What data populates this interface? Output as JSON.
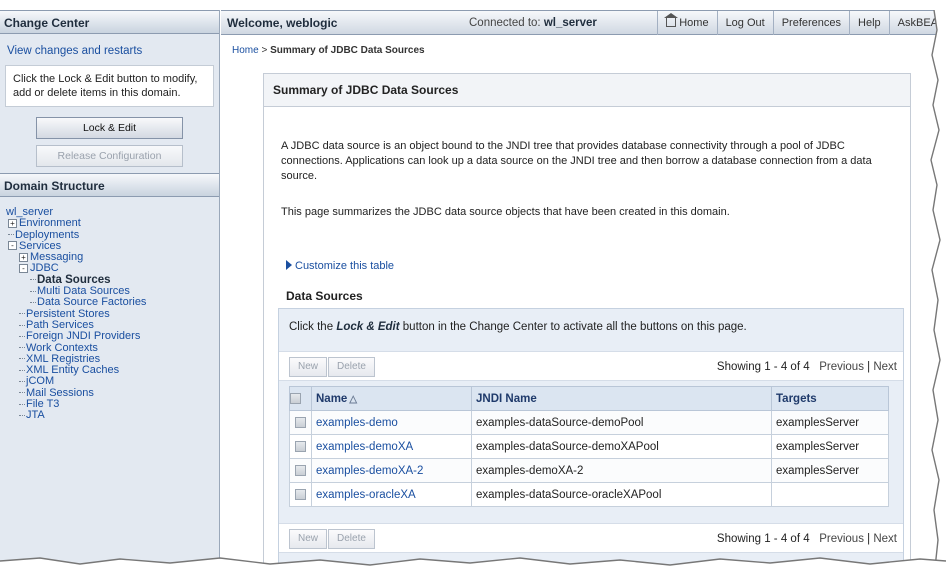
{
  "change_center": {
    "title": "Change Center",
    "link": "View changes and restarts",
    "info": "Click the Lock & Edit button to modify, add or delete items in this domain.",
    "lock_button": "Lock & Edit",
    "release_button": "Release Configuration"
  },
  "domain_structure": {
    "title": "Domain Structure",
    "items": [
      {
        "label": "wl_server",
        "indent": 0,
        "toggle": ""
      },
      {
        "label": "Environment",
        "indent": 1,
        "toggle": "+"
      },
      {
        "label": "Deployments",
        "indent": 1,
        "toggle": ""
      },
      {
        "label": "Services",
        "indent": 1,
        "toggle": "-"
      },
      {
        "label": "Messaging",
        "indent": 2,
        "toggle": "+"
      },
      {
        "label": "JDBC",
        "indent": 2,
        "toggle": "-"
      },
      {
        "label": "Data Sources",
        "indent": 3,
        "toggle": "",
        "current": true
      },
      {
        "label": "Multi Data Sources",
        "indent": 3,
        "toggle": ""
      },
      {
        "label": "Data Source Factories",
        "indent": 3,
        "toggle": ""
      },
      {
        "label": "Persistent Stores",
        "indent": 2,
        "toggle": ""
      },
      {
        "label": "Path Services",
        "indent": 2,
        "toggle": ""
      },
      {
        "label": "Foreign JNDI Providers",
        "indent": 2,
        "toggle": ""
      },
      {
        "label": "Work Contexts",
        "indent": 2,
        "toggle": ""
      },
      {
        "label": "XML Registries",
        "indent": 2,
        "toggle": ""
      },
      {
        "label": "XML Entity Caches",
        "indent": 2,
        "toggle": ""
      },
      {
        "label": "jCOM",
        "indent": 2,
        "toggle": ""
      },
      {
        "label": "Mail Sessions",
        "indent": 2,
        "toggle": ""
      },
      {
        "label": "File T3",
        "indent": 2,
        "toggle": ""
      },
      {
        "label": "JTA",
        "indent": 2,
        "toggle": ""
      }
    ]
  },
  "topbar": {
    "welcome": "Welcome, weblogic",
    "connected_label": "Connected to:",
    "connected_server": "wl_server",
    "links": [
      "Home",
      "Log Out",
      "Preferences",
      "Help",
      "AskBEA"
    ]
  },
  "breadcrumb": {
    "home": "Home",
    "separator": ">",
    "current": "Summary of JDBC Data Sources"
  },
  "page": {
    "title": "Summary of JDBC Data Sources",
    "description": "A JDBC data source is an object bound to the JNDI tree that provides database connectivity through a pool of JDBC connections. Applications can look up a data source on the JNDI tree and then borrow a database connection from a data source.",
    "summary": "This page summarizes the JDBC data source objects that have been created in this domain.",
    "customize_link": "Customize this table",
    "table_title": "Data Sources",
    "lock_msg_prefix": "Click the",
    "lock_msg_em": "Lock & Edit",
    "lock_msg_suffix": "button in the Change Center to activate all the buttons on this page.",
    "new_button": "New",
    "delete_button": "Delete",
    "showing": "Showing 1 - 4 of 4",
    "previous": "Previous",
    "next": "Next",
    "columns": [
      "Name",
      "JNDI Name",
      "Targets"
    ],
    "rows": [
      {
        "name": "examples-demo",
        "jndi": "examples-dataSource-demoPool",
        "targets": "examplesServer"
      },
      {
        "name": "examples-demoXA",
        "jndi": "examples-dataSource-demoXAPool",
        "targets": "examplesServer"
      },
      {
        "name": "examples-demoXA-2",
        "jndi": "examples-demoXA-2",
        "targets": "examplesServer"
      },
      {
        "name": "examples-oracleXA",
        "jndi": "examples-dataSource-oracleXAPool",
        "targets": ""
      }
    ]
  },
  "colors": {
    "link": "#1a4fa0",
    "panel_bg": "#e3e9f1",
    "header_gradient_end": "#c9d3df",
    "table_header_bg": "#dbe5f1"
  }
}
